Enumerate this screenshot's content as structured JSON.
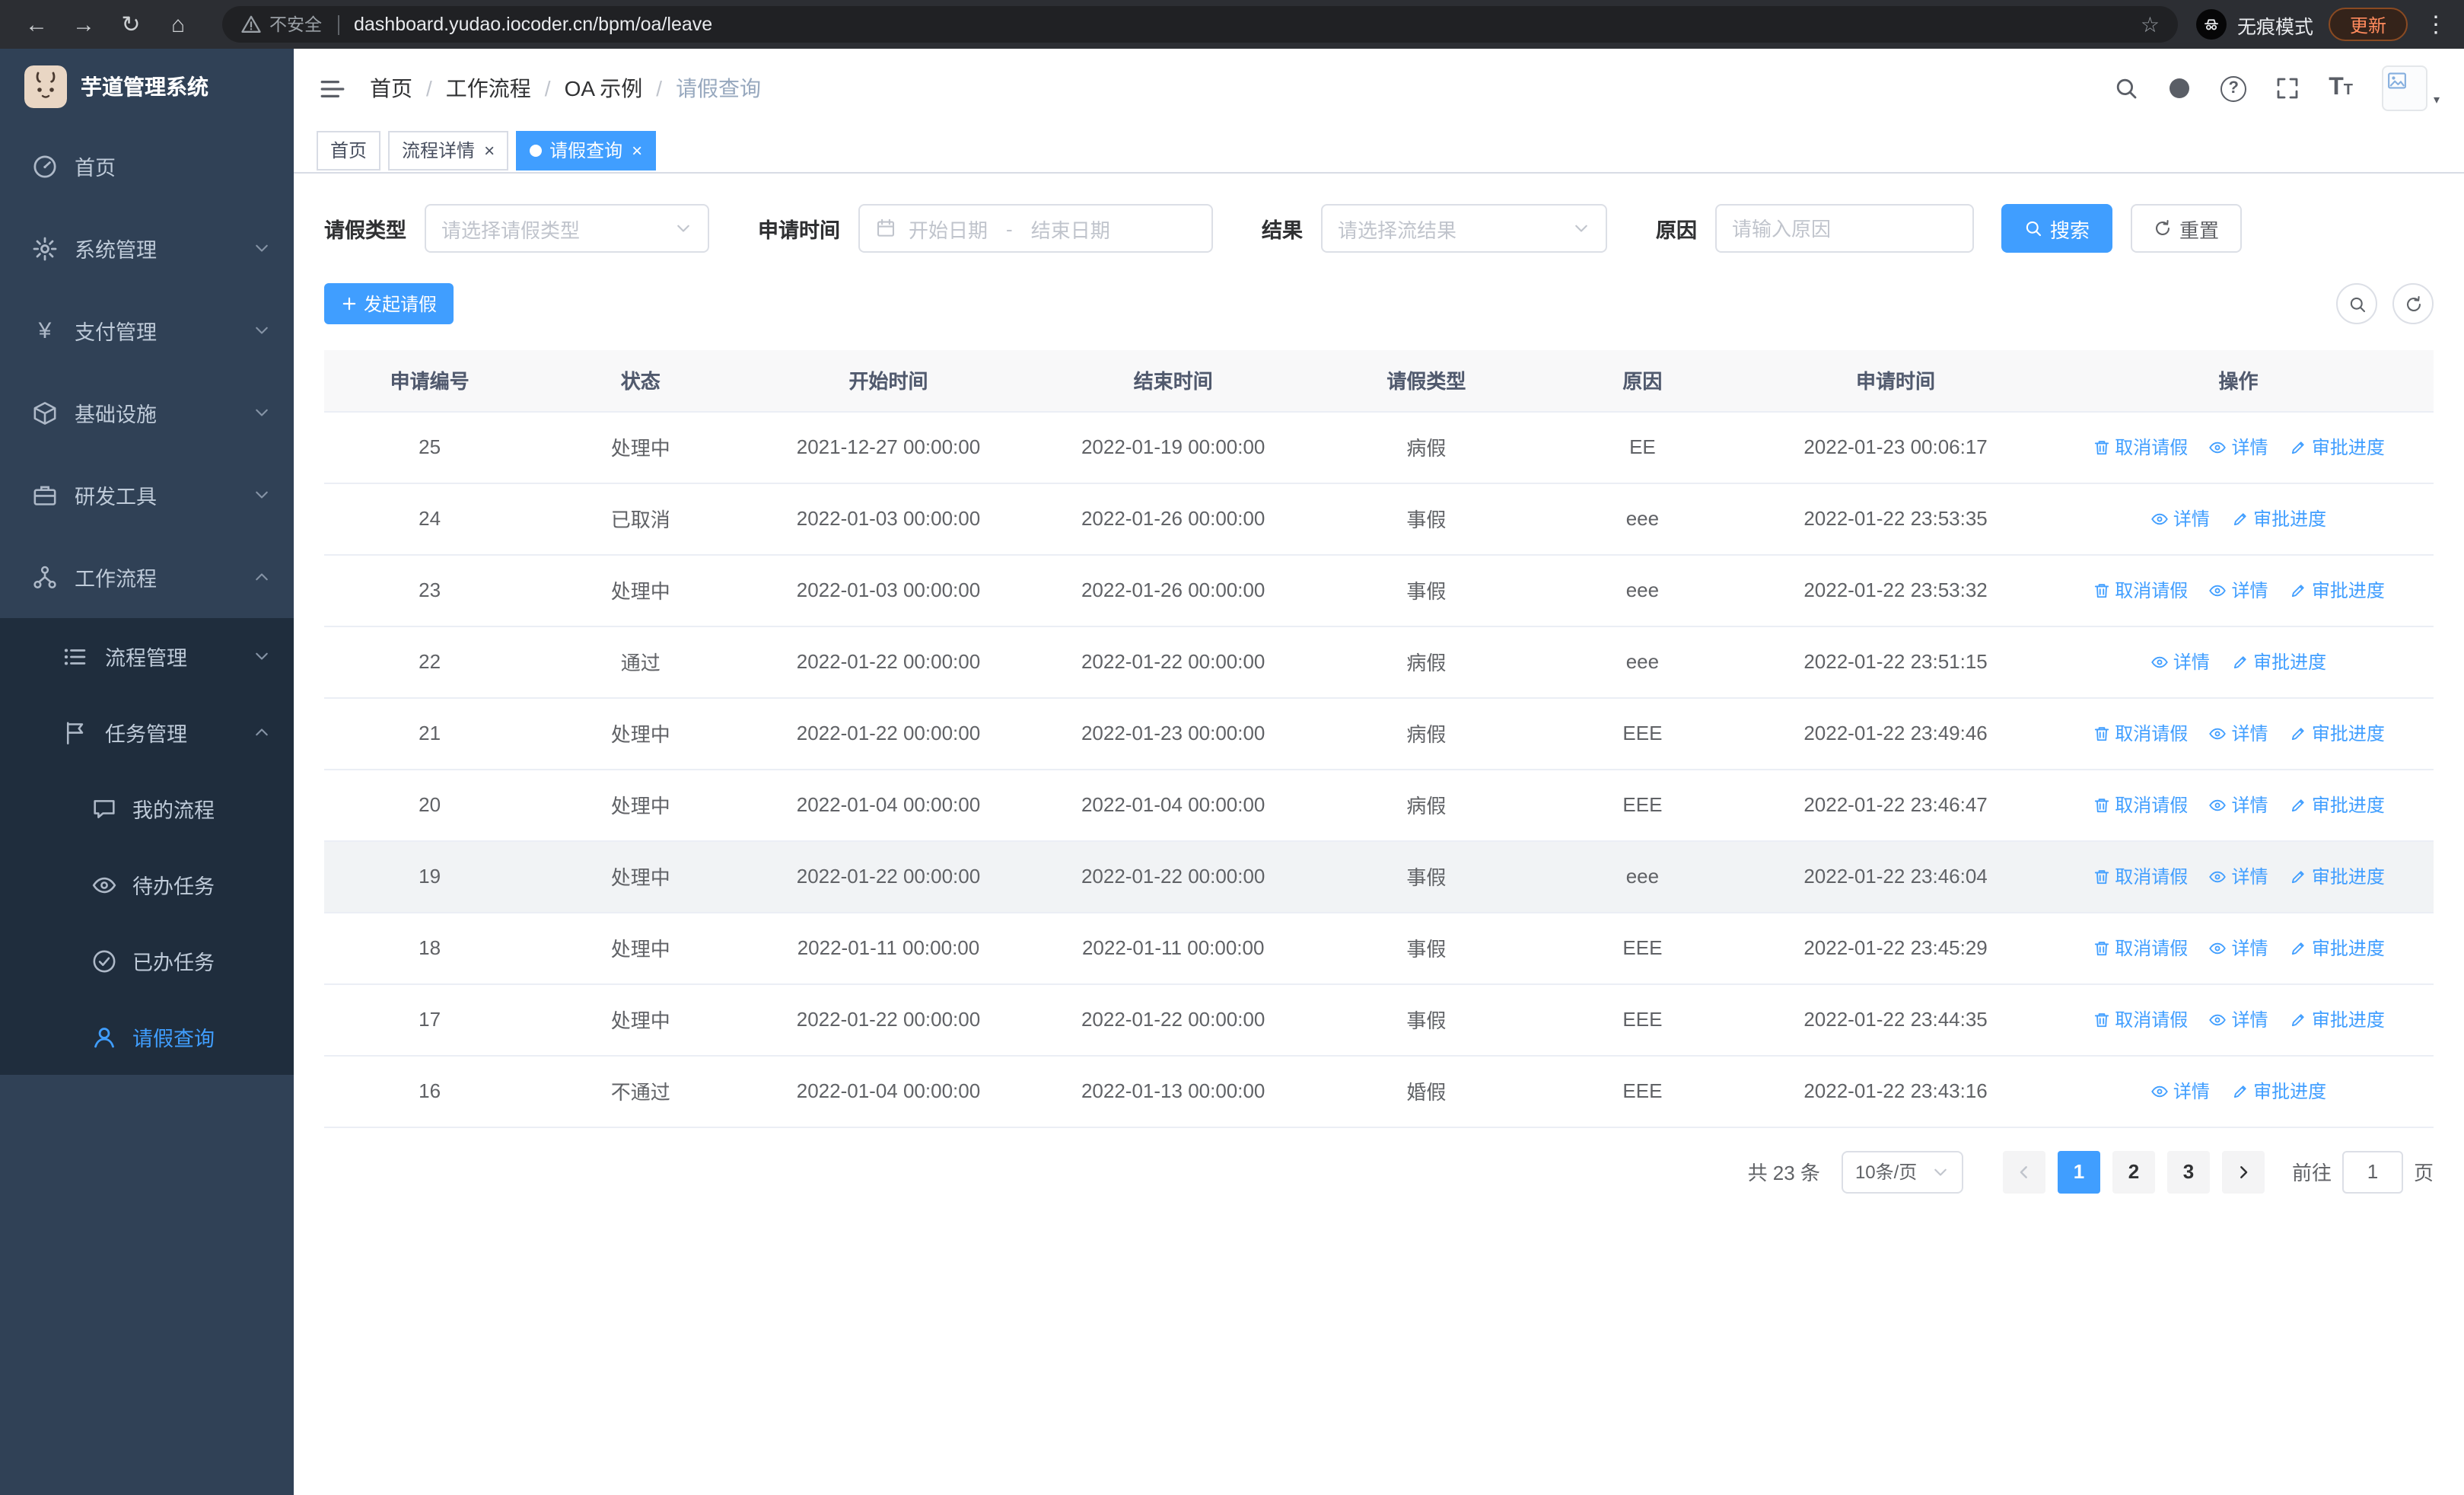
{
  "colors": {
    "accent": "#409eff",
    "sidebar_bg": "#304156",
    "submenu_bg": "#1f2d3d",
    "active_text": "#409eff",
    "danger_update": "#ff8a5c"
  },
  "browser": {
    "security_warning": "不安全",
    "url": "dashboard.yudao.iocoder.cn/bpm/oa/leave",
    "incognito_label": "无痕模式",
    "update_label": "更新"
  },
  "app": {
    "title": "芋道管理系统"
  },
  "sidebar": {
    "items": [
      {
        "label": "首页",
        "expandable": false,
        "expanded": false
      },
      {
        "label": "系统管理",
        "expandable": true,
        "expanded": false
      },
      {
        "label": "支付管理",
        "expandable": true,
        "expanded": false
      },
      {
        "label": "基础设施",
        "expandable": true,
        "expanded": false
      },
      {
        "label": "研发工具",
        "expandable": true,
        "expanded": false
      },
      {
        "label": "工作流程",
        "expandable": true,
        "expanded": true
      }
    ],
    "submenu": [
      {
        "label": "流程管理",
        "expanded": false
      },
      {
        "label": "任务管理",
        "expanded": true
      }
    ],
    "task_items": [
      {
        "label": "我的流程",
        "active": false
      },
      {
        "label": "待办任务",
        "active": false
      },
      {
        "label": "已办任务",
        "active": false
      },
      {
        "label": "请假查询",
        "active": true
      }
    ]
  },
  "breadcrumb": {
    "items": [
      {
        "label": "首页"
      },
      {
        "label": "工作流程"
      },
      {
        "label": "OA 示例"
      },
      {
        "label": "请假查询"
      }
    ]
  },
  "tabs": [
    {
      "label": "首页",
      "closable": false,
      "active": false
    },
    {
      "label": "流程详情",
      "closable": true,
      "active": false
    },
    {
      "label": "请假查询",
      "closable": true,
      "active": true
    }
  ],
  "filters": {
    "leave_type_label": "请假类型",
    "leave_type_placeholder": "请选择请假类型",
    "apply_time_label": "申请时间",
    "start_date_placeholder": "开始日期",
    "range_separator": "-",
    "end_date_placeholder": "结束日期",
    "result_label": "结果",
    "result_placeholder": "请选择流结果",
    "reason_label": "原因",
    "reason_placeholder": "请输入原因",
    "search_label": "搜索",
    "reset_label": "重置"
  },
  "toolbar": {
    "create_label": "发起请假"
  },
  "table": {
    "columns": [
      "申请编号",
      "状态",
      "开始时间",
      "结束时间",
      "请假类型",
      "原因",
      "申请时间",
      "操作"
    ],
    "actions": {
      "cancel": "取消请假",
      "detail": "详情",
      "progress": "审批进度"
    },
    "rows": [
      {
        "id": "25",
        "status": "处理中",
        "start": "2021-12-27 00:00:00",
        "end": "2022-01-19 00:00:00",
        "type": "病假",
        "reason": "EE",
        "applied": "2022-01-23 00:06:17",
        "can_cancel": true,
        "highlight": false
      },
      {
        "id": "24",
        "status": "已取消",
        "start": "2022-01-03 00:00:00",
        "end": "2022-01-26 00:00:00",
        "type": "事假",
        "reason": "eee",
        "applied": "2022-01-22 23:53:35",
        "can_cancel": false,
        "highlight": false
      },
      {
        "id": "23",
        "status": "处理中",
        "start": "2022-01-03 00:00:00",
        "end": "2022-01-26 00:00:00",
        "type": "事假",
        "reason": "eee",
        "applied": "2022-01-22 23:53:32",
        "can_cancel": true,
        "highlight": false
      },
      {
        "id": "22",
        "status": "通过",
        "start": "2022-01-22 00:00:00",
        "end": "2022-01-22 00:00:00",
        "type": "病假",
        "reason": "eee",
        "applied": "2022-01-22 23:51:15",
        "can_cancel": false,
        "highlight": false
      },
      {
        "id": "21",
        "status": "处理中",
        "start": "2022-01-22 00:00:00",
        "end": "2022-01-23 00:00:00",
        "type": "病假",
        "reason": "EEE",
        "applied": "2022-01-22 23:49:46",
        "can_cancel": true,
        "highlight": false
      },
      {
        "id": "20",
        "status": "处理中",
        "start": "2022-01-04 00:00:00",
        "end": "2022-01-04 00:00:00",
        "type": "病假",
        "reason": "EEE",
        "applied": "2022-01-22 23:46:47",
        "can_cancel": true,
        "highlight": false
      },
      {
        "id": "19",
        "status": "处理中",
        "start": "2022-01-22 00:00:00",
        "end": "2022-01-22 00:00:00",
        "type": "事假",
        "reason": "eee",
        "applied": "2022-01-22 23:46:04",
        "can_cancel": true,
        "highlight": true
      },
      {
        "id": "18",
        "status": "处理中",
        "start": "2022-01-11 00:00:00",
        "end": "2022-01-11 00:00:00",
        "type": "事假",
        "reason": "EEE",
        "applied": "2022-01-22 23:45:29",
        "can_cancel": true,
        "highlight": false
      },
      {
        "id": "17",
        "status": "处理中",
        "start": "2022-01-22 00:00:00",
        "end": "2022-01-22 00:00:00",
        "type": "事假",
        "reason": "EEE",
        "applied": "2022-01-22 23:44:35",
        "can_cancel": true,
        "highlight": false
      },
      {
        "id": "16",
        "status": "不通过",
        "start": "2022-01-04 00:00:00",
        "end": "2022-01-13 00:00:00",
        "type": "婚假",
        "reason": "EEE",
        "applied": "2022-01-22 23:43:16",
        "can_cancel": false,
        "highlight": false
      }
    ]
  },
  "pagination": {
    "total_text": "共 23 条",
    "page_size": "10条/页",
    "pages": [
      {
        "label": "1",
        "active": true
      },
      {
        "label": "2",
        "active": false
      },
      {
        "label": "3",
        "active": false
      }
    ],
    "goto_label": "前往",
    "goto_value": "1",
    "page_suffix": "页"
  }
}
